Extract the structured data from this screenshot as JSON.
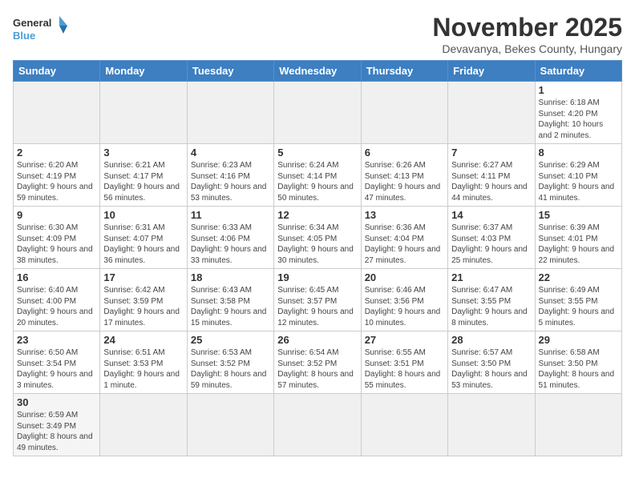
{
  "logo": {
    "general": "General",
    "blue": "Blue"
  },
  "title": "November 2025",
  "location": "Devavanya, Bekes County, Hungary",
  "weekdays": [
    "Sunday",
    "Monday",
    "Tuesday",
    "Wednesday",
    "Thursday",
    "Friday",
    "Saturday"
  ],
  "weeks": [
    [
      {
        "day": "",
        "info": ""
      },
      {
        "day": "",
        "info": ""
      },
      {
        "day": "",
        "info": ""
      },
      {
        "day": "",
        "info": ""
      },
      {
        "day": "",
        "info": ""
      },
      {
        "day": "",
        "info": ""
      },
      {
        "day": "1",
        "info": "Sunrise: 6:18 AM\nSunset: 4:20 PM\nDaylight: 10 hours and 2 minutes."
      }
    ],
    [
      {
        "day": "2",
        "info": "Sunrise: 6:20 AM\nSunset: 4:19 PM\nDaylight: 9 hours and 59 minutes."
      },
      {
        "day": "3",
        "info": "Sunrise: 6:21 AM\nSunset: 4:17 PM\nDaylight: 9 hours and 56 minutes."
      },
      {
        "day": "4",
        "info": "Sunrise: 6:23 AM\nSunset: 4:16 PM\nDaylight: 9 hours and 53 minutes."
      },
      {
        "day": "5",
        "info": "Sunrise: 6:24 AM\nSunset: 4:14 PM\nDaylight: 9 hours and 50 minutes."
      },
      {
        "day": "6",
        "info": "Sunrise: 6:26 AM\nSunset: 4:13 PM\nDaylight: 9 hours and 47 minutes."
      },
      {
        "day": "7",
        "info": "Sunrise: 6:27 AM\nSunset: 4:11 PM\nDaylight: 9 hours and 44 minutes."
      },
      {
        "day": "8",
        "info": "Sunrise: 6:29 AM\nSunset: 4:10 PM\nDaylight: 9 hours and 41 minutes."
      }
    ],
    [
      {
        "day": "9",
        "info": "Sunrise: 6:30 AM\nSunset: 4:09 PM\nDaylight: 9 hours and 38 minutes."
      },
      {
        "day": "10",
        "info": "Sunrise: 6:31 AM\nSunset: 4:07 PM\nDaylight: 9 hours and 36 minutes."
      },
      {
        "day": "11",
        "info": "Sunrise: 6:33 AM\nSunset: 4:06 PM\nDaylight: 9 hours and 33 minutes."
      },
      {
        "day": "12",
        "info": "Sunrise: 6:34 AM\nSunset: 4:05 PM\nDaylight: 9 hours and 30 minutes."
      },
      {
        "day": "13",
        "info": "Sunrise: 6:36 AM\nSunset: 4:04 PM\nDaylight: 9 hours and 27 minutes."
      },
      {
        "day": "14",
        "info": "Sunrise: 6:37 AM\nSunset: 4:03 PM\nDaylight: 9 hours and 25 minutes."
      },
      {
        "day": "15",
        "info": "Sunrise: 6:39 AM\nSunset: 4:01 PM\nDaylight: 9 hours and 22 minutes."
      }
    ],
    [
      {
        "day": "16",
        "info": "Sunrise: 6:40 AM\nSunset: 4:00 PM\nDaylight: 9 hours and 20 minutes."
      },
      {
        "day": "17",
        "info": "Sunrise: 6:42 AM\nSunset: 3:59 PM\nDaylight: 9 hours and 17 minutes."
      },
      {
        "day": "18",
        "info": "Sunrise: 6:43 AM\nSunset: 3:58 PM\nDaylight: 9 hours and 15 minutes."
      },
      {
        "day": "19",
        "info": "Sunrise: 6:45 AM\nSunset: 3:57 PM\nDaylight: 9 hours and 12 minutes."
      },
      {
        "day": "20",
        "info": "Sunrise: 6:46 AM\nSunset: 3:56 PM\nDaylight: 9 hours and 10 minutes."
      },
      {
        "day": "21",
        "info": "Sunrise: 6:47 AM\nSunset: 3:55 PM\nDaylight: 9 hours and 8 minutes."
      },
      {
        "day": "22",
        "info": "Sunrise: 6:49 AM\nSunset: 3:55 PM\nDaylight: 9 hours and 5 minutes."
      }
    ],
    [
      {
        "day": "23",
        "info": "Sunrise: 6:50 AM\nSunset: 3:54 PM\nDaylight: 9 hours and 3 minutes."
      },
      {
        "day": "24",
        "info": "Sunrise: 6:51 AM\nSunset: 3:53 PM\nDaylight: 9 hours and 1 minute."
      },
      {
        "day": "25",
        "info": "Sunrise: 6:53 AM\nSunset: 3:52 PM\nDaylight: 8 hours and 59 minutes."
      },
      {
        "day": "26",
        "info": "Sunrise: 6:54 AM\nSunset: 3:52 PM\nDaylight: 8 hours and 57 minutes."
      },
      {
        "day": "27",
        "info": "Sunrise: 6:55 AM\nSunset: 3:51 PM\nDaylight: 8 hours and 55 minutes."
      },
      {
        "day": "28",
        "info": "Sunrise: 6:57 AM\nSunset: 3:50 PM\nDaylight: 8 hours and 53 minutes."
      },
      {
        "day": "29",
        "info": "Sunrise: 6:58 AM\nSunset: 3:50 PM\nDaylight: 8 hours and 51 minutes."
      }
    ],
    [
      {
        "day": "30",
        "info": "Sunrise: 6:59 AM\nSunset: 3:49 PM\nDaylight: 8 hours and 49 minutes."
      },
      {
        "day": "",
        "info": ""
      },
      {
        "day": "",
        "info": ""
      },
      {
        "day": "",
        "info": ""
      },
      {
        "day": "",
        "info": ""
      },
      {
        "day": "",
        "info": ""
      },
      {
        "day": "",
        "info": ""
      }
    ]
  ]
}
